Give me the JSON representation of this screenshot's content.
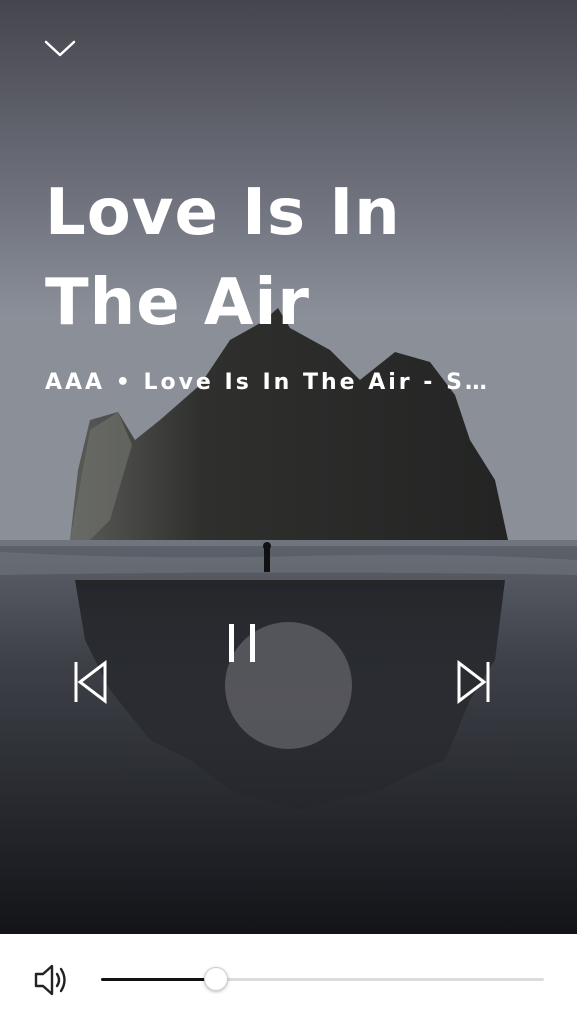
{
  "player": {
    "title": "Love Is In The Air",
    "subtitle": "AAA • Love Is In The Air - S…"
  },
  "icons": {
    "collapse": "chevron-down-icon",
    "previous": "skip-previous-icon",
    "pause": "pause-icon",
    "next": "skip-next-icon",
    "volume": "volume-icon"
  },
  "volume": {
    "level": 0.26
  },
  "colors": {
    "text": "#ffffff",
    "slider_fill": "#111111",
    "slider_track": "#dcdcdc",
    "play_button_bg": "rgba(120,120,126,0.55)"
  }
}
